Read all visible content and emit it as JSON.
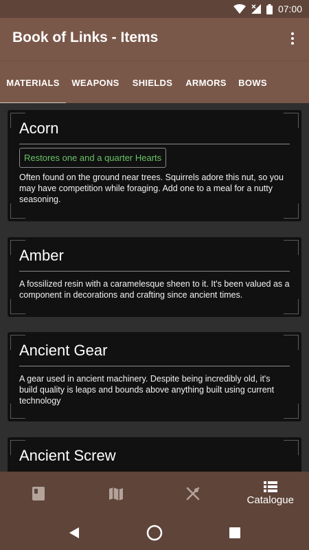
{
  "status_bar": {
    "time": "07:00"
  },
  "app_bar": {
    "title": "Book of Links - Items"
  },
  "tabs": [
    {
      "label": "MATERIALS",
      "active": true
    },
    {
      "label": "WEAPONS",
      "active": false
    },
    {
      "label": "SHIELDS",
      "active": false
    },
    {
      "label": "ARMORS",
      "active": false
    },
    {
      "label": "BOWS",
      "active": false
    }
  ],
  "items": [
    {
      "name": "Acorn",
      "effect": "Restores one and a quarter Hearts",
      "description": "Often found on the ground near trees. Squirrels adore this nut, so you may have competition while foraging. Add one to a meal for a nutty seasoning."
    },
    {
      "name": "Amber",
      "description": "A fossilized resin with a caramelesque sheen to it. It's been valued as a component in decorations and crafting since ancient times."
    },
    {
      "name": "Ancient Gear",
      "description": "A gear used in ancient machinery. Despite being incredibly old, it's build quality is leaps and bounds above anything built using current technology"
    },
    {
      "name": "Ancient Screw"
    }
  ],
  "bottom_nav": {
    "items": [
      {
        "icon": "book-icon"
      },
      {
        "icon": "map-icon"
      },
      {
        "icon": "fork-knife-icon"
      },
      {
        "icon": "list-icon",
        "label": "Catalogue",
        "active": true
      }
    ]
  },
  "colors": {
    "status_bar": "#5f4439",
    "app_bar": "#7a5849",
    "background": "#2f2f2f",
    "card": "#111111",
    "effect_text": "#68c367"
  }
}
